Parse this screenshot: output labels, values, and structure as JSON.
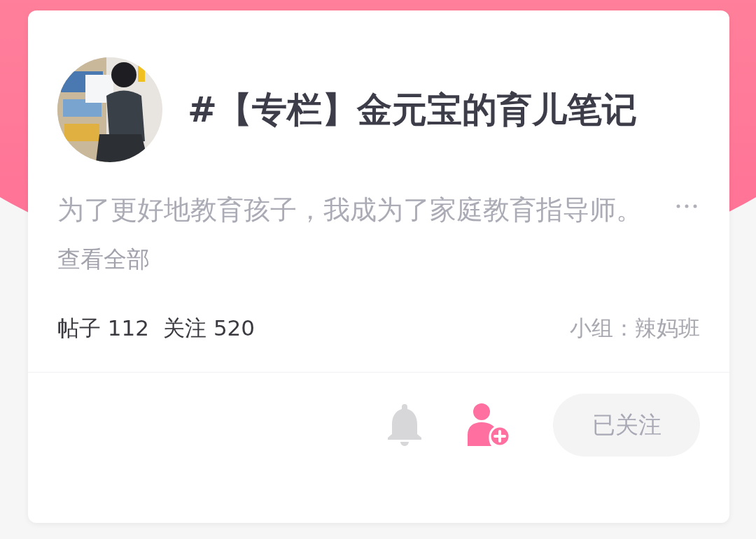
{
  "column": {
    "title": "#【专栏】金元宝的育儿笔记",
    "description": "为了更好地教育孩子，我成为了家庭教育指导师。",
    "expand_label": "查看全部",
    "stats": [
      {
        "label": "帖子",
        "value": "112"
      },
      {
        "label": "关注",
        "value": "520"
      }
    ],
    "group": "小组：辣妈班",
    "follow_button": {
      "label": "已关注",
      "followed": true
    }
  }
}
